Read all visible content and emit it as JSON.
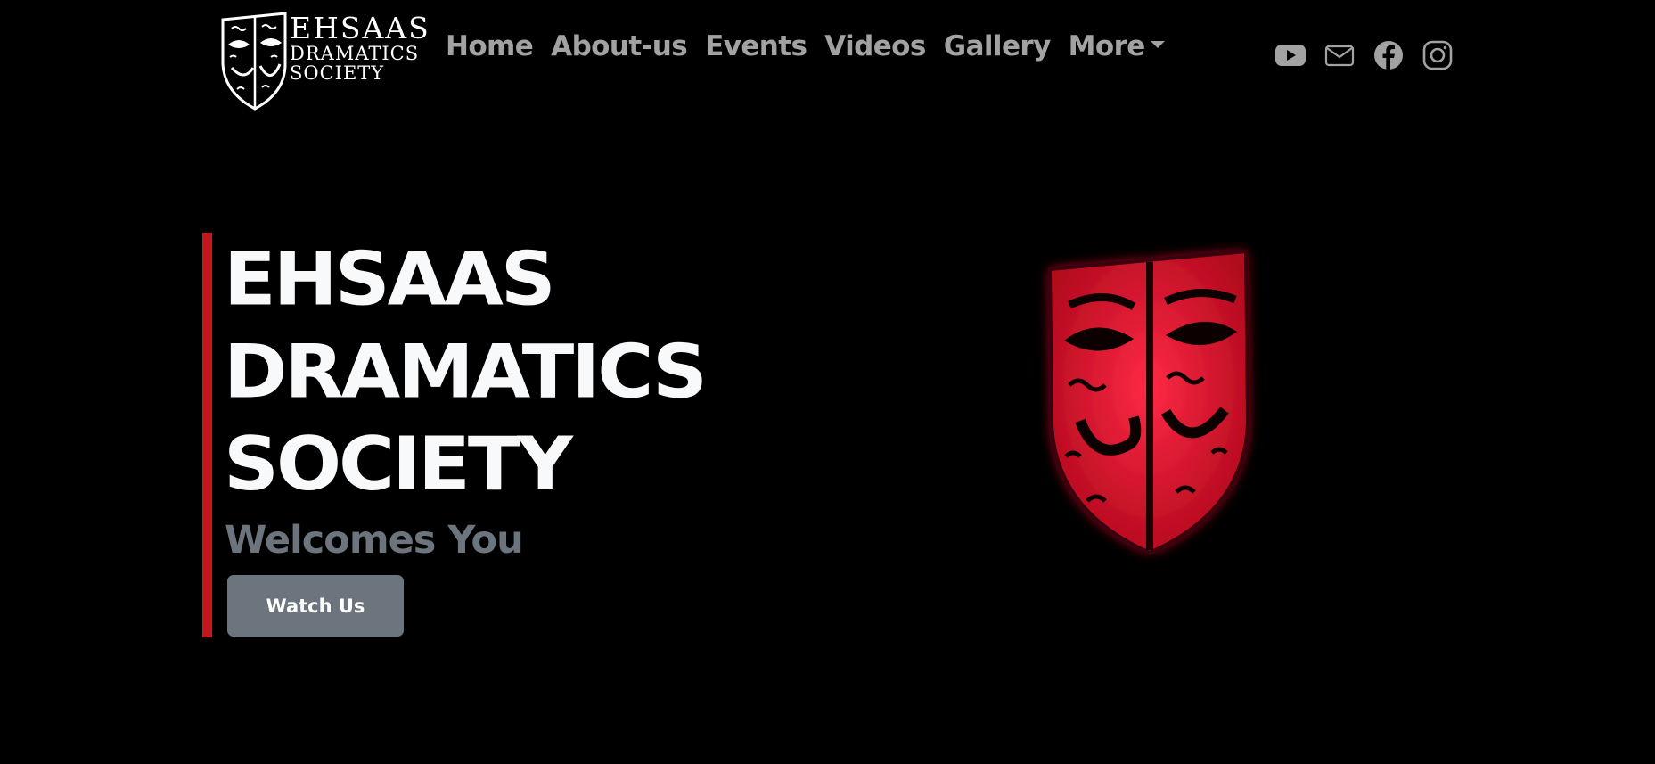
{
  "header": {
    "logo": {
      "line1": "EHSAAS",
      "line2": "DRAMATICS",
      "line3": "SOCIETY",
      "icon": "theatre-mask-icon"
    },
    "nav": [
      {
        "label": "Home"
      },
      {
        "label": "About-us"
      },
      {
        "label": "Events"
      },
      {
        "label": "Videos"
      },
      {
        "label": "Gallery"
      },
      {
        "label": "More",
        "dropdown": true
      }
    ],
    "socials": [
      {
        "icon": "youtube-icon"
      },
      {
        "icon": "mail-icon"
      },
      {
        "icon": "facebook-icon"
      },
      {
        "icon": "instagram-icon"
      }
    ]
  },
  "hero": {
    "title_lines": [
      "EHSAAS",
      "DRAMATICS",
      "SOCIETY"
    ],
    "subtitle": "Welcomes You",
    "button_label": "Watch Us",
    "image_icon": "red-theatre-mask-icon"
  },
  "colors": {
    "background": "#000000",
    "accent_bar": "#c4161c",
    "nav_text": "#a2a2a2",
    "title_text": "#f8f9fa",
    "subtitle_text": "#6c757d",
    "button_bg": "#6c757d",
    "mask_red": "#e0102a"
  }
}
